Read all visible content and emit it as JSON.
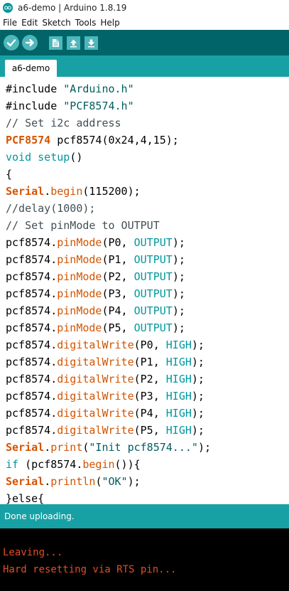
{
  "window": {
    "title": "a6-demo | Arduino 1.8.19"
  },
  "menu": [
    "File",
    "Edit",
    "Sketch",
    "Tools",
    "Help"
  ],
  "toolbar": {
    "icons": [
      "verify-icon",
      "upload-icon",
      "new-icon",
      "open-icon",
      "save-icon"
    ]
  },
  "tab": {
    "label": "a6-demo"
  },
  "code": {
    "lines": [
      [
        {
          "t": "#include ",
          "c": ""
        },
        {
          "t": "\"Arduino.h\"",
          "c": "str"
        }
      ],
      [
        {
          "t": "#include ",
          "c": ""
        },
        {
          "t": "\"PCF8574.h\"",
          "c": "str"
        }
      ],
      [
        {
          "t": "// Set i2c address",
          "c": "cmt"
        }
      ],
      [
        {
          "t": "PCF8574",
          "c": "kw-bold"
        },
        {
          "t": " pcf8574(0x24,4,15);",
          "c": ""
        }
      ],
      [
        {
          "t": "void",
          "c": "kw-type"
        },
        {
          "t": " ",
          "c": ""
        },
        {
          "t": "setup",
          "c": "kw-type"
        },
        {
          "t": "()",
          "c": ""
        }
      ],
      [
        {
          "t": "{",
          "c": ""
        }
      ],
      [
        {
          "t": "Serial",
          "c": "kw-bold"
        },
        {
          "t": ".",
          "c": ""
        },
        {
          "t": "begin",
          "c": "kw-orange"
        },
        {
          "t": "(115200);",
          "c": ""
        }
      ],
      [
        {
          "t": "//delay(1000);",
          "c": "cmt"
        }
      ],
      [
        {
          "t": "// Set pinMode to OUTPUT",
          "c": "cmt"
        }
      ],
      [
        {
          "t": "pcf8574.",
          "c": ""
        },
        {
          "t": "pinMode",
          "c": "kw-orange"
        },
        {
          "t": "(P0, ",
          "c": ""
        },
        {
          "t": "OUTPUT",
          "c": "kw-const"
        },
        {
          "t": ");",
          "c": ""
        }
      ],
      [
        {
          "t": "pcf8574.",
          "c": ""
        },
        {
          "t": "pinMode",
          "c": "kw-orange"
        },
        {
          "t": "(P1, ",
          "c": ""
        },
        {
          "t": "OUTPUT",
          "c": "kw-const"
        },
        {
          "t": ");",
          "c": ""
        }
      ],
      [
        {
          "t": "pcf8574.",
          "c": ""
        },
        {
          "t": "pinMode",
          "c": "kw-orange"
        },
        {
          "t": "(P2, ",
          "c": ""
        },
        {
          "t": "OUTPUT",
          "c": "kw-const"
        },
        {
          "t": ");",
          "c": ""
        }
      ],
      [
        {
          "t": "pcf8574.",
          "c": ""
        },
        {
          "t": "pinMode",
          "c": "kw-orange"
        },
        {
          "t": "(P3, ",
          "c": ""
        },
        {
          "t": "OUTPUT",
          "c": "kw-const"
        },
        {
          "t": ");",
          "c": ""
        }
      ],
      [
        {
          "t": "pcf8574.",
          "c": ""
        },
        {
          "t": "pinMode",
          "c": "kw-orange"
        },
        {
          "t": "(P4, ",
          "c": ""
        },
        {
          "t": "OUTPUT",
          "c": "kw-const"
        },
        {
          "t": ");",
          "c": ""
        }
      ],
      [
        {
          "t": "pcf8574.",
          "c": ""
        },
        {
          "t": "pinMode",
          "c": "kw-orange"
        },
        {
          "t": "(P5, ",
          "c": ""
        },
        {
          "t": "OUTPUT",
          "c": "kw-const"
        },
        {
          "t": ");",
          "c": ""
        }
      ],
      [
        {
          "t": "pcf8574.",
          "c": ""
        },
        {
          "t": "digitalWrite",
          "c": "kw-orange"
        },
        {
          "t": "(P0, ",
          "c": ""
        },
        {
          "t": "HIGH",
          "c": "kw-const"
        },
        {
          "t": ");",
          "c": ""
        }
      ],
      [
        {
          "t": "pcf8574.",
          "c": ""
        },
        {
          "t": "digitalWrite",
          "c": "kw-orange"
        },
        {
          "t": "(P1, ",
          "c": ""
        },
        {
          "t": "HIGH",
          "c": "kw-const"
        },
        {
          "t": ");",
          "c": ""
        }
      ],
      [
        {
          "t": "pcf8574.",
          "c": ""
        },
        {
          "t": "digitalWrite",
          "c": "kw-orange"
        },
        {
          "t": "(P2, ",
          "c": ""
        },
        {
          "t": "HIGH",
          "c": "kw-const"
        },
        {
          "t": ");",
          "c": ""
        }
      ],
      [
        {
          "t": "pcf8574.",
          "c": ""
        },
        {
          "t": "digitalWrite",
          "c": "kw-orange"
        },
        {
          "t": "(P3, ",
          "c": ""
        },
        {
          "t": "HIGH",
          "c": "kw-const"
        },
        {
          "t": ");",
          "c": ""
        }
      ],
      [
        {
          "t": "pcf8574.",
          "c": ""
        },
        {
          "t": "digitalWrite",
          "c": "kw-orange"
        },
        {
          "t": "(P4, ",
          "c": ""
        },
        {
          "t": "HIGH",
          "c": "kw-const"
        },
        {
          "t": ");",
          "c": ""
        }
      ],
      [
        {
          "t": "pcf8574.",
          "c": ""
        },
        {
          "t": "digitalWrite",
          "c": "kw-orange"
        },
        {
          "t": "(P5, ",
          "c": ""
        },
        {
          "t": "HIGH",
          "c": "kw-const"
        },
        {
          "t": ");",
          "c": ""
        }
      ],
      [
        {
          "t": "Serial",
          "c": "kw-bold"
        },
        {
          "t": ".",
          "c": ""
        },
        {
          "t": "print",
          "c": "kw-orange"
        },
        {
          "t": "(",
          "c": ""
        },
        {
          "t": "\"Init pcf8574...\"",
          "c": "str"
        },
        {
          "t": ");",
          "c": ""
        }
      ],
      [
        {
          "t": "if",
          "c": "kw-type"
        },
        {
          "t": " (pcf8574.",
          "c": ""
        },
        {
          "t": "begin",
          "c": "kw-orange"
        },
        {
          "t": "()){",
          "c": ""
        }
      ],
      [
        {
          "t": "Serial",
          "c": "kw-bold"
        },
        {
          "t": ".",
          "c": ""
        },
        {
          "t": "println",
          "c": "kw-orange"
        },
        {
          "t": "(",
          "c": ""
        },
        {
          "t": "\"OK\"",
          "c": "str"
        },
        {
          "t": ");",
          "c": ""
        }
      ],
      [
        {
          "t": "}else{",
          "c": ""
        }
      ]
    ]
  },
  "status": {
    "text": "Done uploading."
  },
  "console": {
    "lines": [
      "Leaving...",
      "Hard resetting via RTS pin..."
    ]
  },
  "colors": {
    "toolbar": "#006468",
    "tabbar": "#17a1a5",
    "keyword": "#d35400",
    "type": "#00979c",
    "console_text": "#e34c26"
  }
}
